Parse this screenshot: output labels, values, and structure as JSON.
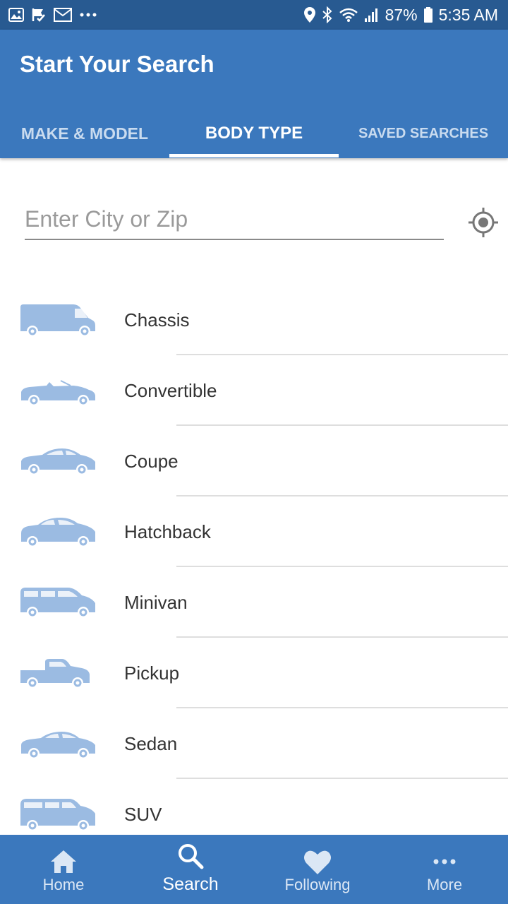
{
  "status_bar": {
    "battery": "87%",
    "time": "5:35 AM",
    "left_icons": [
      "image-icon",
      "check-flag-icon",
      "gmail-icon",
      "more-dots-icon"
    ],
    "right_icons": [
      "location-pin-icon",
      "bluetooth-icon",
      "wifi-icon",
      "signal-icon",
      "battery-icon"
    ]
  },
  "header": {
    "title": "Start Your Search"
  },
  "tabs": [
    {
      "label": "MAKE & MODEL",
      "active": false
    },
    {
      "label": "BODY TYPE",
      "active": true
    },
    {
      "label": "SAVED SEARCHES",
      "active": false
    }
  ],
  "search": {
    "placeholder": "Enter City or Zip",
    "value": "",
    "location_icon": "target-location-icon"
  },
  "body_types": [
    {
      "label": "Chassis",
      "icon": "van-icon"
    },
    {
      "label": "Convertible",
      "icon": "convertible-icon"
    },
    {
      "label": "Coupe",
      "icon": "coupe-icon"
    },
    {
      "label": "Hatchback",
      "icon": "hatchback-icon"
    },
    {
      "label": "Minivan",
      "icon": "minivan-icon"
    },
    {
      "label": "Pickup",
      "icon": "pickup-icon"
    },
    {
      "label": "Sedan",
      "icon": "sedan-icon"
    },
    {
      "label": "SUV",
      "icon": "suv-icon"
    }
  ],
  "bottom_nav": [
    {
      "label": "Home",
      "icon": "home-icon",
      "active": false
    },
    {
      "label": "Search",
      "icon": "search-icon",
      "active": true
    },
    {
      "label": "Following",
      "icon": "heart-icon",
      "active": false
    },
    {
      "label": "More",
      "icon": "more-icon",
      "active": false
    }
  ],
  "colors": {
    "primary": "#3b78bd",
    "status_bar": "#285a91",
    "car_icon": "#9bbbe2"
  }
}
